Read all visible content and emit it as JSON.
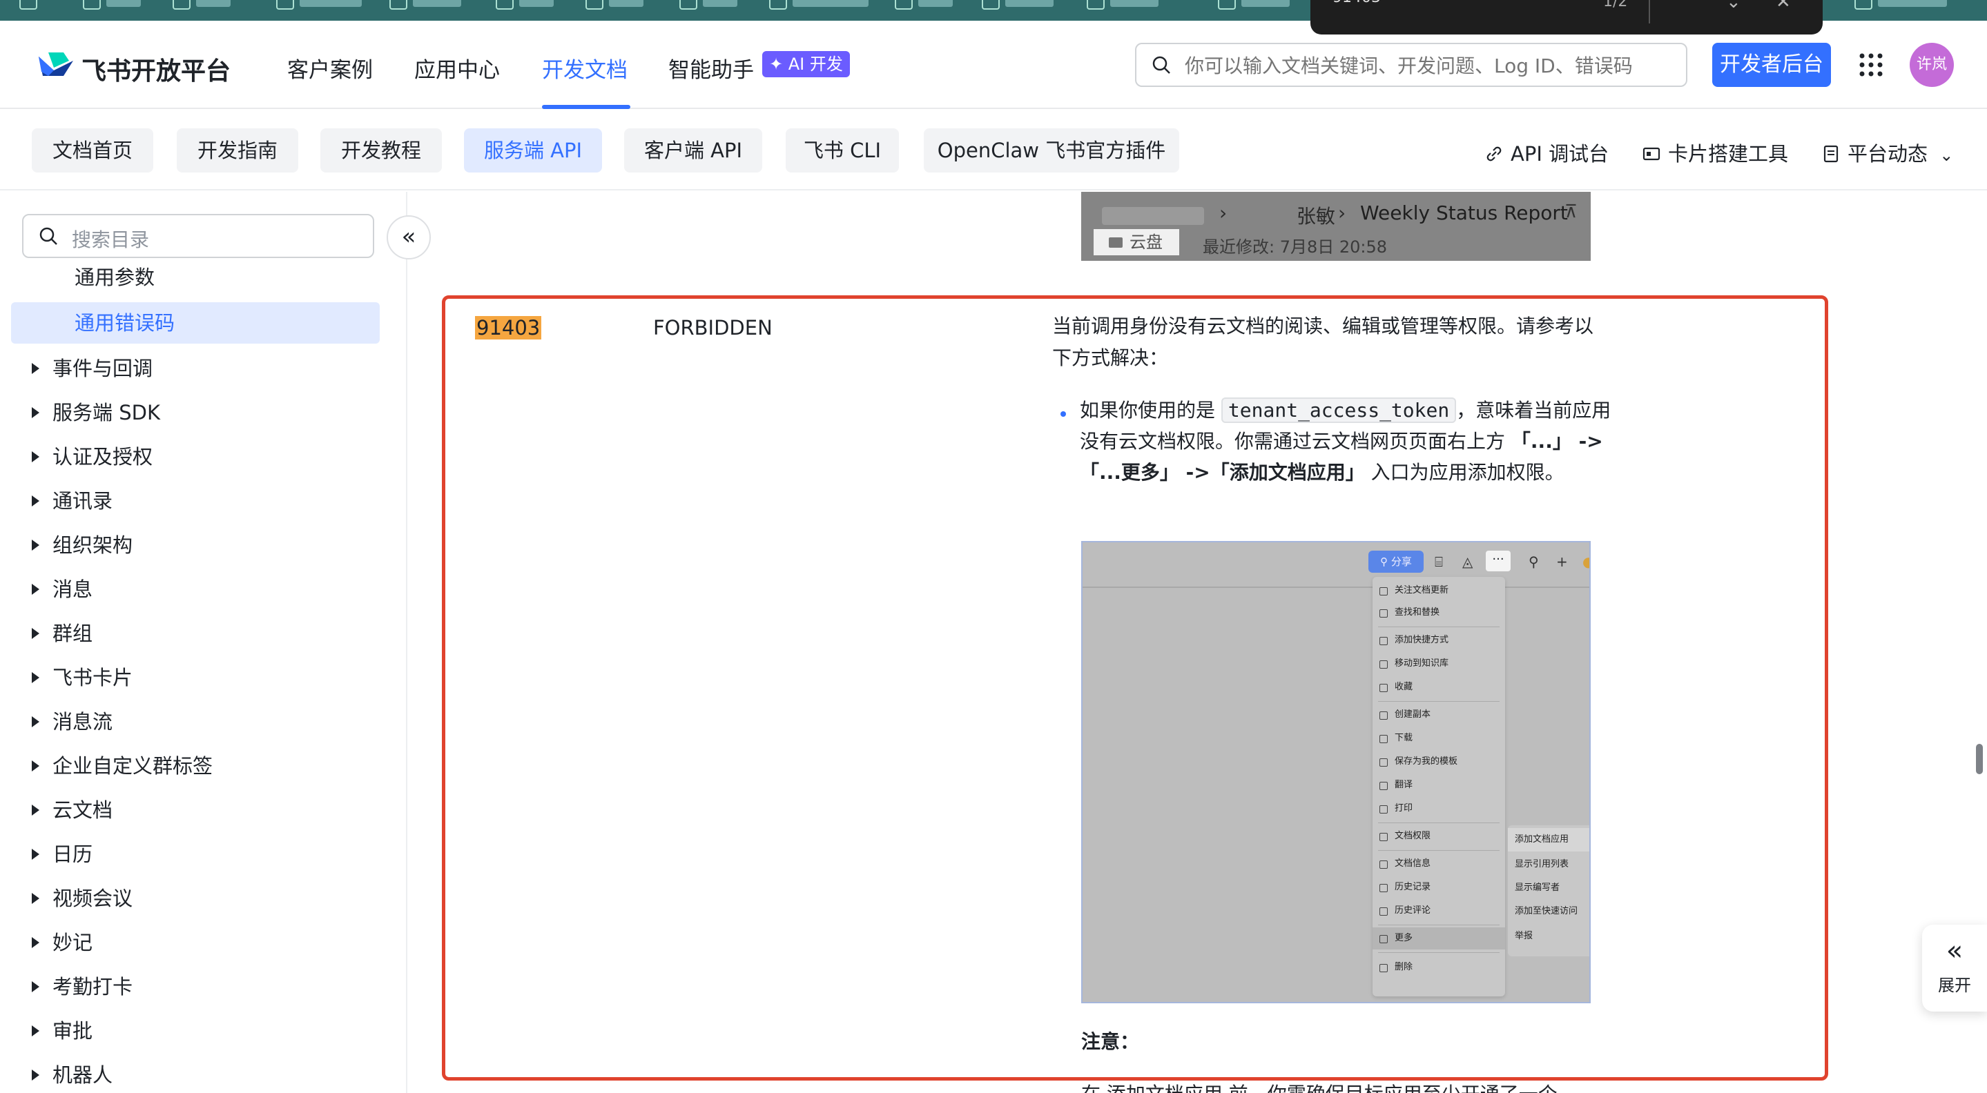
{
  "findbar": {
    "query": "91403",
    "count": "1/2"
  },
  "header": {
    "brand": "飞书开放平台",
    "nav": [
      "客户案例",
      "应用中心",
      "开发文档",
      "智能助手"
    ],
    "ai_badge": "✦ AI 开发",
    "search_placeholder": "你可以输入文档关键词、开发问题、Log ID、错误码",
    "dev_console": "开发者后台",
    "avatar": "许岚"
  },
  "tabs": [
    "文档首页",
    "开发指南",
    "开发教程",
    "服务端 API",
    "客户端 API",
    "飞书 CLI",
    "OpenClaw 飞书官方插件"
  ],
  "tools": {
    "api_debug": "API 调试台",
    "card_builder": "卡片搭建工具",
    "platform_news": "平台动态"
  },
  "sidebar": {
    "search_placeholder": "搜索目录",
    "sub_items": [
      "通用参数",
      "通用错误码"
    ],
    "items": [
      "事件与回调",
      "服务端 SDK",
      "认证及授权",
      "通讯录",
      "组织架构",
      "消息",
      "群组",
      "飞书卡片",
      "消息流",
      "企业自定义群标签",
      "云文档",
      "日历",
      "视频会议",
      "妙记",
      "考勤打卡",
      "审批",
      "机器人"
    ]
  },
  "screenshot_top": {
    "owner": "张敏",
    "doc_title": "Weekly Status Report",
    "folder": "云盘",
    "modified": "最近修改: 7月8日 20:58"
  },
  "error_row": {
    "code": "91403",
    "name": "FORBIDDEN",
    "description": "当前调用身份没有云文档的阅读、编辑或管理等权限。请参考以下方式解决：",
    "bullet_prefix": "如果你使用的是",
    "bullet_code": "tenant_access_token",
    "bullet_mid": "，意味着当前应用没有云文档权限。你需通过云文档网页页面右上方",
    "bullet_path": "「...」 ->「...更多」 ->「添加文档应用」",
    "bullet_suffix": "入口为应用添加权限。"
  },
  "doc_menu": {
    "share": "分享",
    "items": [
      "关注文档更新",
      "查找和替换",
      "添加快捷方式",
      "移动到知识库",
      "收藏",
      "创建副本",
      "下载",
      "保存为我的模板",
      "翻译",
      "打印",
      "文档权限",
      "文档信息",
      "历史记录",
      "历史评论",
      "更多",
      "删除"
    ],
    "submenu": [
      "添加文档应用",
      "显示引用列表",
      "显示编写者",
      "添加至快速访问",
      "举报"
    ]
  },
  "note_label": "注意：",
  "below_text": "在 添加文档应用 前，你需确保目标应用至少开通了一个",
  "expand_label": "展开"
}
